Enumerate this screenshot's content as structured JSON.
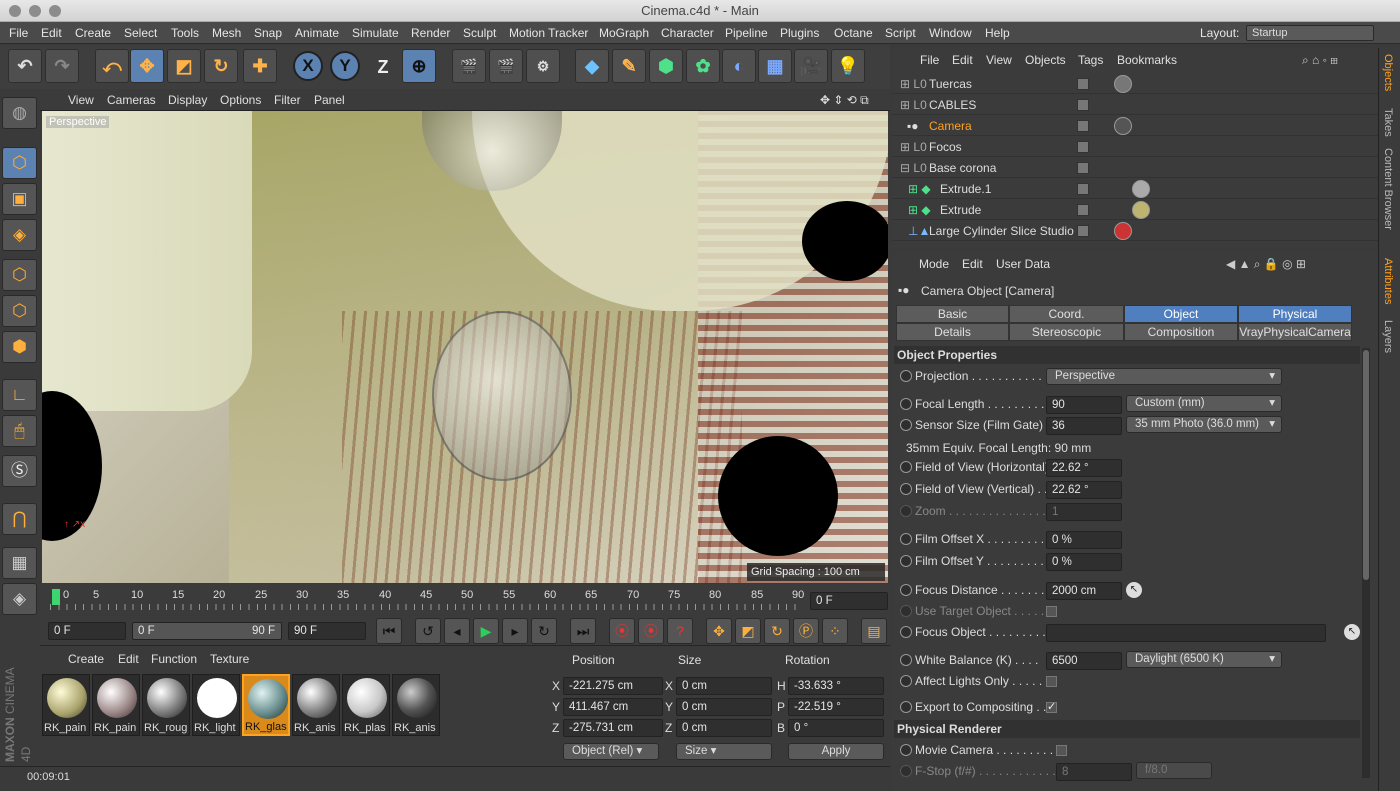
{
  "window": {
    "title": "Cinema.c4d * - Main"
  },
  "menu": [
    "File",
    "Edit",
    "Create",
    "Select",
    "Tools",
    "Mesh",
    "Snap",
    "Animate",
    "Simulate",
    "Render",
    "Sculpt",
    "Motion Tracker",
    "MoGraph",
    "Character",
    "Pipeline",
    "Plugins",
    "Octane",
    "Script",
    "Window",
    "Help"
  ],
  "layout": {
    "label": "Layout:",
    "value": "Startup"
  },
  "viewport": {
    "menu": [
      "View",
      "Cameras",
      "Display",
      "Options",
      "Filter",
      "Panel"
    ],
    "label": "Perspective",
    "grid_spacing": "Grid Spacing : 100 cm"
  },
  "timeline": {
    "ticks": [
      "0",
      "5",
      "10",
      "15",
      "20",
      "25",
      "30",
      "35",
      "40",
      "45",
      "50",
      "55",
      "60",
      "65",
      "70",
      "75",
      "80",
      "85",
      "90"
    ],
    "current_frame": "0 F"
  },
  "transport": {
    "start": "0 F",
    "range_start": "0 F",
    "range_end": "90 F",
    "end": "90 F"
  },
  "material_manager": {
    "menu": [
      "Create",
      "Edit",
      "Function",
      "Texture"
    ],
    "materials": [
      "RK_pain",
      "RK_pain",
      "RK_roug",
      "RK_light",
      "RK_glas",
      "RK_anis",
      "RK_plas",
      "RK_anis"
    ]
  },
  "coordinates": {
    "headers": [
      "Position",
      "Size",
      "Rotation"
    ],
    "rows": [
      {
        "axis": "X",
        "pos": "-221.275 cm",
        "size_axis": "X",
        "size": "0 cm",
        "rot_axis": "H",
        "rot": "-33.633 °"
      },
      {
        "axis": "Y",
        "pos": "411.467 cm",
        "size_axis": "Y",
        "size": "0 cm",
        "rot_axis": "P",
        "rot": "-22.519 °"
      },
      {
        "axis": "Z",
        "pos": "-275.731 cm",
        "size_axis": "Z",
        "size": "0 cm",
        "rot_axis": "B",
        "rot": "0 °"
      }
    ],
    "mode": "Object (Rel)",
    "size_mode": "Size",
    "apply": "Apply"
  },
  "status": {
    "time": "00:09:01"
  },
  "brand": {
    "line1": "MAXON",
    "line2": "CINEMA 4D"
  },
  "object_manager": {
    "menu": [
      "File",
      "Edit",
      "View",
      "Objects",
      "Tags",
      "Bookmarks"
    ],
    "objects": [
      {
        "name": "Tuercas"
      },
      {
        "name": "CABLES"
      },
      {
        "name": "Camera"
      },
      {
        "name": "Focos"
      },
      {
        "name": "Base corona"
      },
      {
        "name": "Extrude.1"
      },
      {
        "name": "Extrude"
      },
      {
        "name": "Large Cylinder Slice Studio"
      }
    ]
  },
  "attributes": {
    "menu": [
      "Mode",
      "Edit",
      "User Data"
    ],
    "object_title": "Camera Object [Camera]",
    "tabs_row1": [
      "Basic",
      "Coord.",
      "Object",
      "Physical"
    ],
    "tabs_row2": [
      "Details",
      "Stereoscopic",
      "Composition",
      "VrayPhysicalCamera"
    ],
    "section1": "Object Properties",
    "projection": {
      "label": "Projection . . . . . . . . . . . .",
      "value": "Perspective"
    },
    "focal_length": {
      "label": "Focal Length . . . . . . . . .",
      "value": "90",
      "preset": "Custom (mm)"
    },
    "sensor_size": {
      "label": "Sensor Size (Film Gate)",
      "value": "36",
      "preset": "35 mm Photo (36.0 mm)"
    },
    "equiv_focal": "35mm Equiv. Focal Length: 90 mm",
    "fov_h": {
      "label": "Field of View (Horizontal)",
      "value": "22.62 °"
    },
    "fov_v": {
      "label": "Field of View (Vertical) . .",
      "value": "22.62 °"
    },
    "zoom": {
      "label": "Zoom . . . . . . . . . . . . . . .",
      "value": "1"
    },
    "film_offset_x": {
      "label": "Film Offset X . . . . . . . . .",
      "value": "0 %"
    },
    "film_offset_y": {
      "label": "Film Offset Y . . . . . . . . .",
      "value": "0 %"
    },
    "focus_distance": {
      "label": "Focus Distance . . . . . . .",
      "value": "2000 cm"
    },
    "use_target": {
      "label": "Use Target Object . . . . ."
    },
    "focus_object": {
      "label": "Focus Object . . . . . . . . ."
    },
    "white_balance": {
      "label": "White Balance (K) . . . .",
      "value": "6500",
      "preset": "Daylight (6500 K)"
    },
    "affect_lights": {
      "label": "Affect Lights Only . . . . ."
    },
    "export_comp": {
      "label": "Export to Compositing . .",
      "check": "✓"
    },
    "section2": "Physical Renderer",
    "movie_camera": {
      "label": "Movie Camera . . . . . . . . . ."
    },
    "fstop": {
      "label": "F-Stop (f/#) . . . . . . . . . . . . .",
      "value": "8",
      "preset": "f/8.0"
    }
  },
  "side_tabs": [
    "Objects",
    "Takes",
    "Content Browser",
    "Attributes",
    "Layers"
  ],
  "colors": {
    "accent": "#ffa21e",
    "selected_tab": "#4f7fbf",
    "tool_blue": "#5b82b0"
  }
}
